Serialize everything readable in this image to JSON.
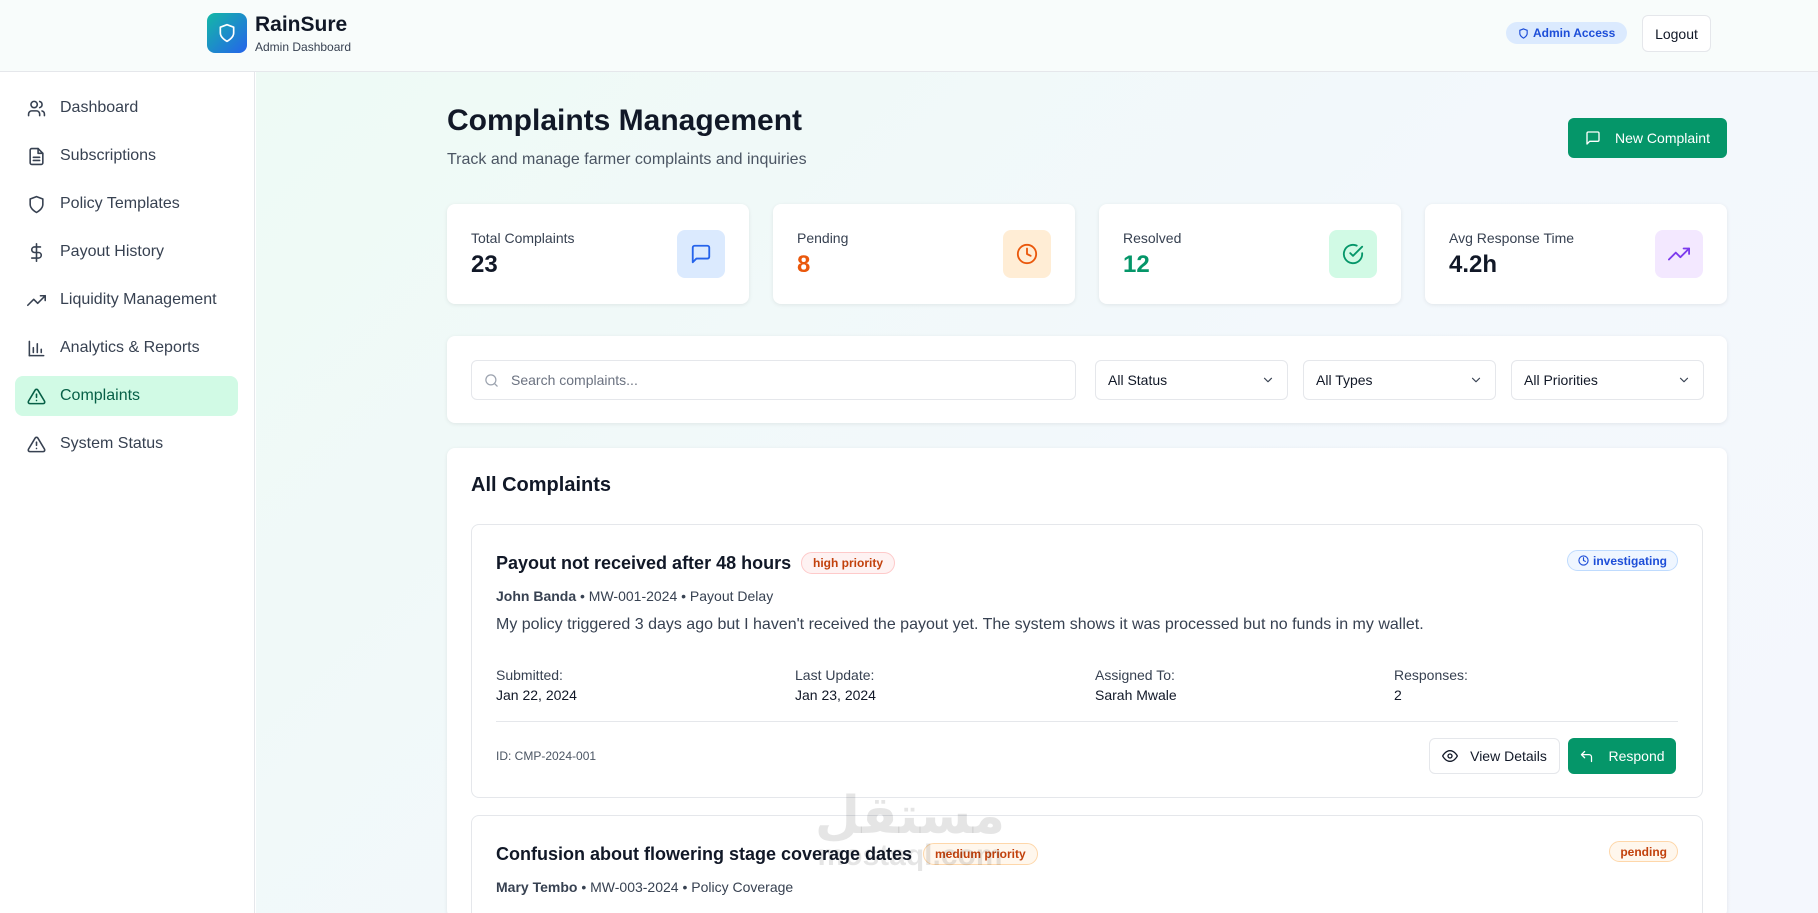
{
  "header": {
    "brand_name": "RainSure",
    "brand_sub": "Admin Dashboard",
    "admin_badge": "Admin Access",
    "logout_label": "Logout"
  },
  "sidebar": {
    "items": [
      {
        "label": "Dashboard",
        "icon": "users-icon"
      },
      {
        "label": "Subscriptions",
        "icon": "document-icon"
      },
      {
        "label": "Policy Templates",
        "icon": "shield-icon"
      },
      {
        "label": "Payout History",
        "icon": "dollar-icon"
      },
      {
        "label": "Liquidity Management",
        "icon": "trending-up-icon"
      },
      {
        "label": "Analytics & Reports",
        "icon": "bar-chart-icon"
      },
      {
        "label": "Complaints",
        "icon": "alert-triangle-icon",
        "active": true
      },
      {
        "label": "System Status",
        "icon": "alert-triangle-icon"
      }
    ]
  },
  "page": {
    "title": "Complaints Management",
    "subtitle": "Track and manage farmer complaints and inquiries",
    "new_button": "New Complaint"
  },
  "stats": [
    {
      "label": "Total Complaints",
      "value": "23",
      "icon": "message-square-icon",
      "color": "#111827",
      "bg": "#dbeafe",
      "icon_color": "#2563eb"
    },
    {
      "label": "Pending",
      "value": "8",
      "icon": "clock-icon",
      "color": "#ea580c",
      "bg": "#ffedd5",
      "icon_color": "#ea580c"
    },
    {
      "label": "Resolved",
      "value": "12",
      "icon": "check-circle-icon",
      "color": "#059669",
      "bg": "#d1fae5",
      "icon_color": "#059669"
    },
    {
      "label": "Avg Response Time",
      "value": "4.2h",
      "icon": "trending-up-icon",
      "color": "#111827",
      "bg": "#f3e8ff",
      "icon_color": "#7c3aed"
    }
  ],
  "filters": {
    "search_placeholder": "Search complaints...",
    "status": "All Status",
    "types": "All Types",
    "priorities": "All Priorities"
  },
  "list": {
    "title": "All Complaints",
    "complaints": [
      {
        "title": "Payout not received after 48 hours",
        "priority": "high priority",
        "status": "investigating",
        "farmer": "John Banda",
        "meta": " • MW-001-2024 • Payout Delay",
        "description": "My policy triggered 3 days ago but I haven't received the payout yet. The system shows it was processed but no funds in my wallet.",
        "submitted_label": "Submitted:",
        "submitted": "Jan 22, 2024",
        "updated_label": "Last Update:",
        "updated": "Jan 23, 2024",
        "assigned_label": "Assigned To:",
        "assigned": "Sarah Mwale",
        "responses_label": "Responses:",
        "responses": "2",
        "id": "ID: CMP-2024-001",
        "view_label": "View Details",
        "respond_label": "Respond"
      },
      {
        "title": "Confusion about flowering stage coverage dates",
        "priority": "medium priority",
        "status": "pending",
        "farmer": "Mary Tembo",
        "meta": " • MW-003-2024 • Policy Coverage"
      }
    ]
  },
  "colors": {
    "accent": "#059669",
    "active_nav_bg": "#d1fae5"
  }
}
